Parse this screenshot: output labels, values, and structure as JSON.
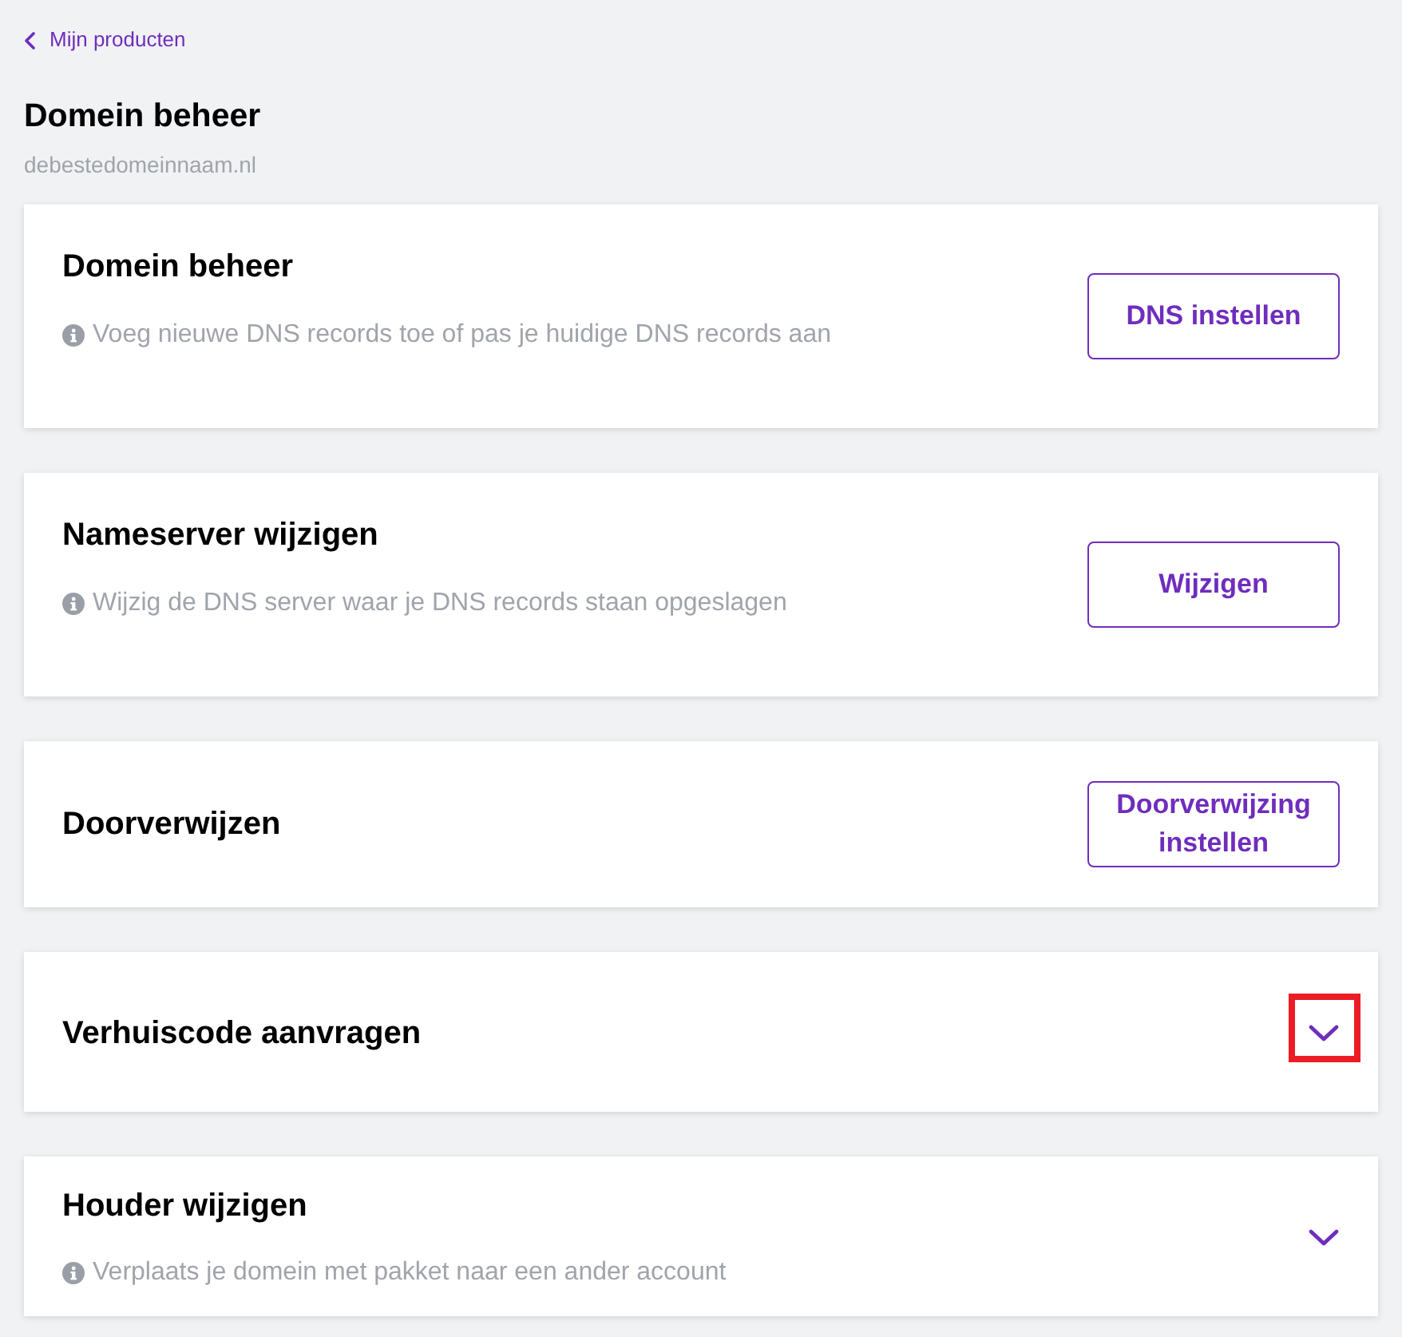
{
  "back_link": {
    "label": "Mijn producten"
  },
  "page": {
    "title": "Domein beheer",
    "subtitle": "debestedomeinnaam.nl"
  },
  "cards": [
    {
      "kind": "button",
      "title": "Domein beheer",
      "description": "Voeg nieuwe DNS records toe of pas je huidige DNS records aan",
      "button": "DNS instellen",
      "highlighted": false
    },
    {
      "kind": "button",
      "title": "Nameserver wijzigen",
      "description": "Wijzig de DNS server waar je DNS records staan opgeslagen",
      "button": "Wijzigen",
      "highlighted": false
    },
    {
      "kind": "button",
      "title": "Doorverwijzen",
      "button": "Doorverwijzing instellen",
      "highlighted": false
    },
    {
      "kind": "expand",
      "title": "Verhuiscode aanvragen",
      "expanded": false,
      "highlighted": true
    },
    {
      "kind": "expand",
      "title": "Houder wijzigen",
      "description": "Verplaats je domein met pakket naar een ander account",
      "expanded": false,
      "highlighted": false
    }
  ]
}
